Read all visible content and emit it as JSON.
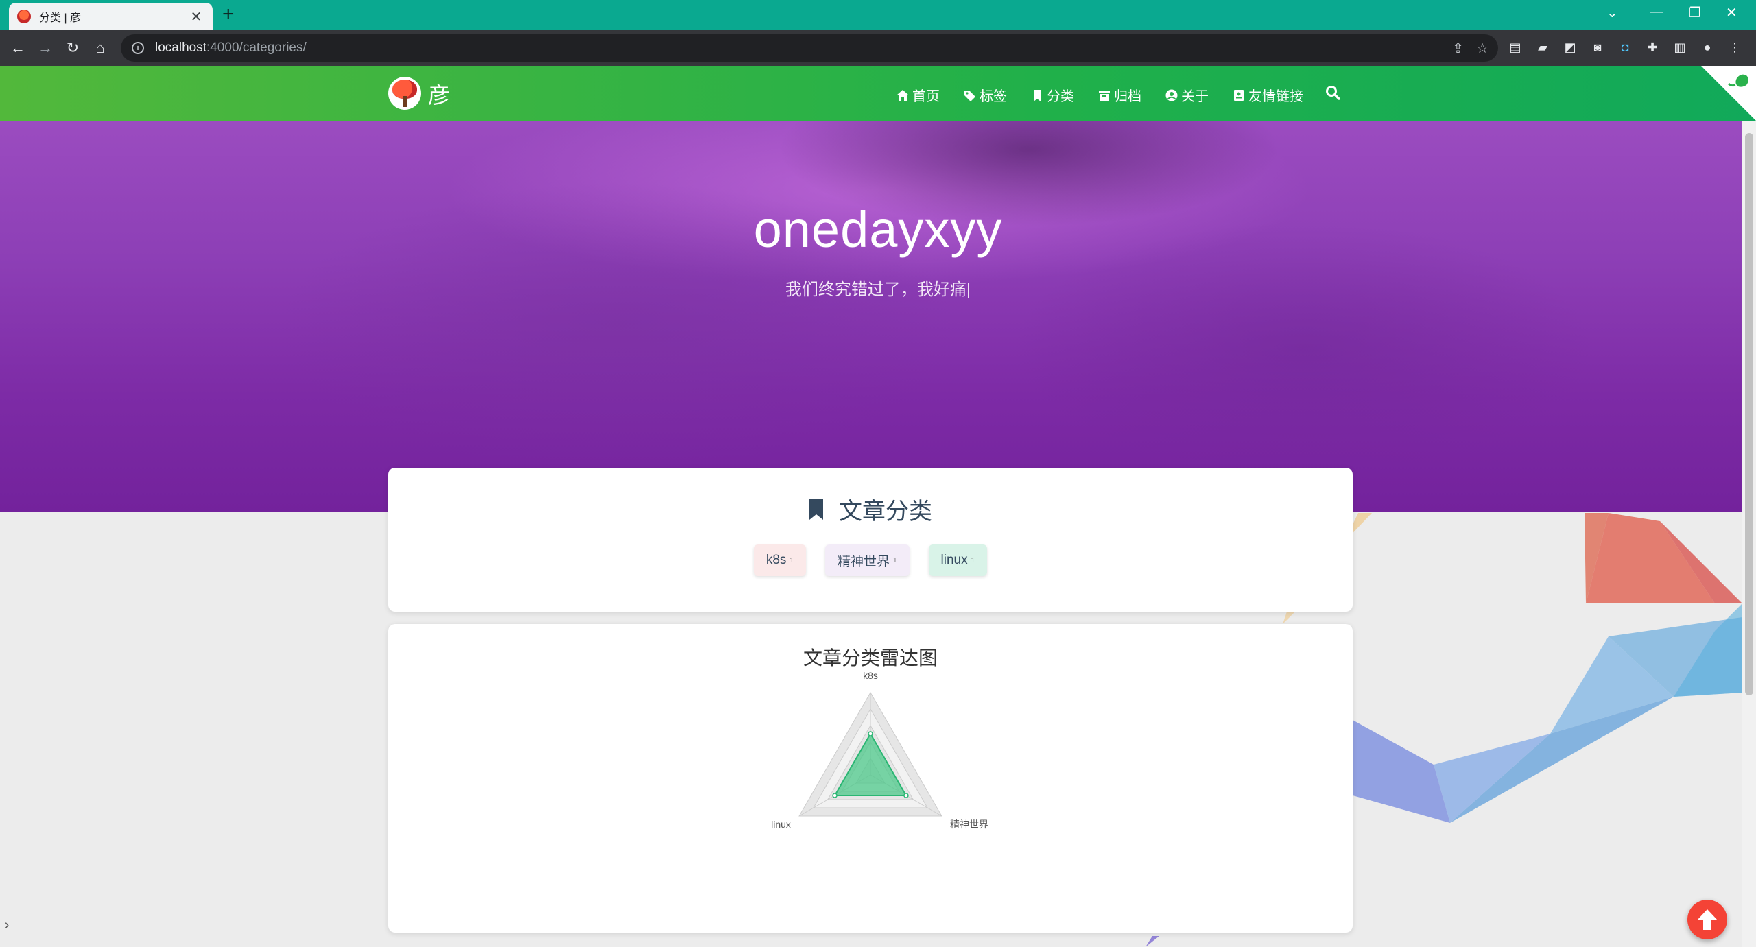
{
  "browser": {
    "tab_title": "分类 | 彦",
    "tab_close": "✕",
    "new_tab": "+",
    "url_host": "localhost",
    "url_path": ":4000/categories/"
  },
  "site": {
    "name": "彦",
    "menu": [
      {
        "label": "首页",
        "icon": "home-icon"
      },
      {
        "label": "标签",
        "icon": "tags-icon"
      },
      {
        "label": "分类",
        "icon": "bookmark-icon"
      },
      {
        "label": "归档",
        "icon": "archive-icon"
      },
      {
        "label": "关于",
        "icon": "user-circle-icon"
      },
      {
        "label": "友情链接",
        "icon": "address-book-icon"
      }
    ]
  },
  "hero": {
    "title": "onedayxyy",
    "subtitle": "我们终究错过了，我好痛|"
  },
  "categories_card": {
    "heading": "文章分类",
    "chips": [
      {
        "label": "k8s",
        "count": "1"
      },
      {
        "label": "精神世界",
        "count": "1"
      },
      {
        "label": "linux",
        "count": "1"
      }
    ]
  },
  "radar_card": {
    "title": "文章分类雷达图"
  },
  "chart_data": {
    "type": "radar",
    "title": "文章分类雷达图",
    "categories": [
      "k8s",
      "精神世界",
      "linux"
    ],
    "series": [
      {
        "values": [
          1,
          1,
          1
        ]
      }
    ],
    "max": 2,
    "colors": {
      "fill": "#4cc88a",
      "stroke": "#2bb673"
    }
  }
}
